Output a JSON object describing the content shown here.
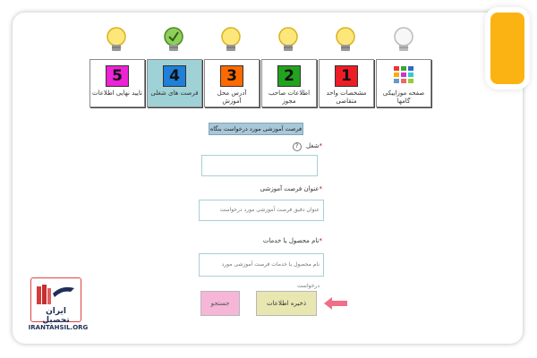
{
  "steps": [
    {
      "label": "صفحه موزاییکی گامها",
      "icon": "grid-icon",
      "bulb": "bulb-icon"
    },
    {
      "number": "1",
      "label": "مشخصات واحد متقاضی",
      "color": "#ee1c24",
      "bulb": "bulb-icon"
    },
    {
      "number": "2",
      "label": "اطلاعات صاحب مجوز",
      "color": "#22a31e",
      "bulb": "bulb-icon"
    },
    {
      "number": "3",
      "label": "آدرس محل آموزش",
      "color": "#ff6a00",
      "bulb": "bulb-icon"
    },
    {
      "number": "4",
      "label": "فرصت های شغلی",
      "color": "#1f7fd9",
      "bulb": "bulb-check-icon",
      "active": true
    },
    {
      "number": "5",
      "label": "تایید نهایی اطلاعات",
      "color": "#ee22d6",
      "bulb": "bulb-icon"
    }
  ],
  "form": {
    "title": "فرصت آموزشی مورد درخواست بنگاه",
    "job_label": "شغل",
    "job_value": "",
    "title_label": "عنوان فرصت آموزشی",
    "title_placeholder": "عنوان دقیق فرصت آموزشی مورد درخواست",
    "product_label": "نام محصول یا خدمات",
    "product_placeholder": "نام محصول یا خدمات فرصت آموزشی مورد درخواست"
  },
  "buttons": {
    "search": "جستجو",
    "save": "ذخیره اطلاعات"
  },
  "logo": {
    "name": "ایران تحصیل",
    "site": "IRANTAHSIL.ORG"
  },
  "colors": {
    "accent": "#fbb313",
    "active_tile": "#9fd2d6",
    "save_button": "#e8e7b2",
    "search_button": "#f5b6d7",
    "arrow": "#ef6f86"
  }
}
